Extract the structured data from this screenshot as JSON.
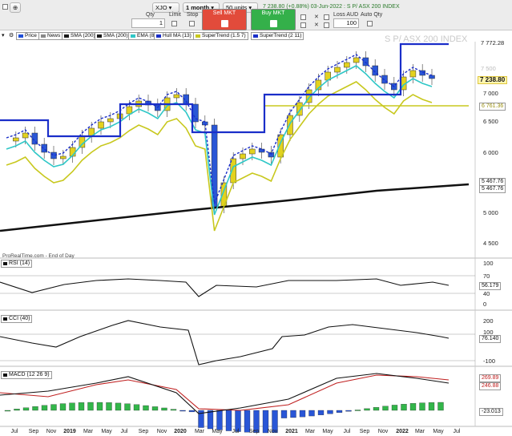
{
  "toolbar": {
    "qty_label": "Qty",
    "qty_value": "1",
    "limit_label": "Limit",
    "stop_label": "Stop",
    "sell_label": "Sell MKT",
    "buy_label": "Buy MKT",
    "symbol": "XJO",
    "timeframe": "1 month",
    "units": "50 units",
    "loss_label": "Loss AUD",
    "loss_value": "100",
    "autoqty_label": "Auto Qty",
    "quote": "7 238.80 (+0.88%) 03-Jun-2022 : S P/ ASX 200 INDEX",
    "colors": {
      "sell": "#e24b3b",
      "buy": "#34b04a"
    }
  },
  "indicators": [
    {
      "label": "Price",
      "color": "#1f4fd8"
    },
    {
      "label": "News",
      "color": "#888888"
    },
    {
      "label": "SMA (200)",
      "color": "#1a1a1a"
    },
    {
      "label": "SMA (200)",
      "color": "#1a1a1a"
    },
    {
      "label": "EMA (8)",
      "color": "#2fc7c7"
    },
    {
      "label": "Hull MA (13)",
      "color": "#1a2ec9"
    },
    {
      "label": "SuperTrend (1.5 7)",
      "color": "#c8c81e"
    },
    {
      "label": "SuperTrend (2 11)",
      "color": "#1a2ec9"
    }
  ],
  "main_panel": {
    "watermark": "S P/ ASX 200 INDEX",
    "source": "ProRealTime.com - End of Day",
    "axis_labels": [
      "7 772.28",
      "7 500",
      "7 238.80",
      "7 000",
      "6 761.36",
      "6 500",
      "6 000",
      "5 467.76",
      "5 467.76",
      "5 000",
      "4 500"
    ],
    "last_price": "7 238.80"
  },
  "rsi_panel": {
    "title": "RSI (14)",
    "axis_labels": [
      "100",
      "70",
      "56.179",
      "40",
      "0"
    ]
  },
  "cci_panel": {
    "title": "CCI (40)",
    "axis_labels": [
      "200",
      "100",
      "76.140",
      "-100"
    ]
  },
  "macd_panel": {
    "title": "MACD (12 26 9)",
    "axis_labels": [
      "269.89",
      "246.88",
      "-23.013"
    ]
  },
  "x_axis": [
    "Jul",
    "Sep",
    "Nov",
    "2019",
    "Mar",
    "May",
    "Jul",
    "Sep",
    "Nov",
    "2020",
    "Mar",
    "May",
    "Jul",
    "Sep",
    "Nov",
    "2021",
    "Mar",
    "May",
    "Jul",
    "Sep",
    "Nov",
    "2022",
    "Mar",
    "May",
    "Jul"
  ]
}
